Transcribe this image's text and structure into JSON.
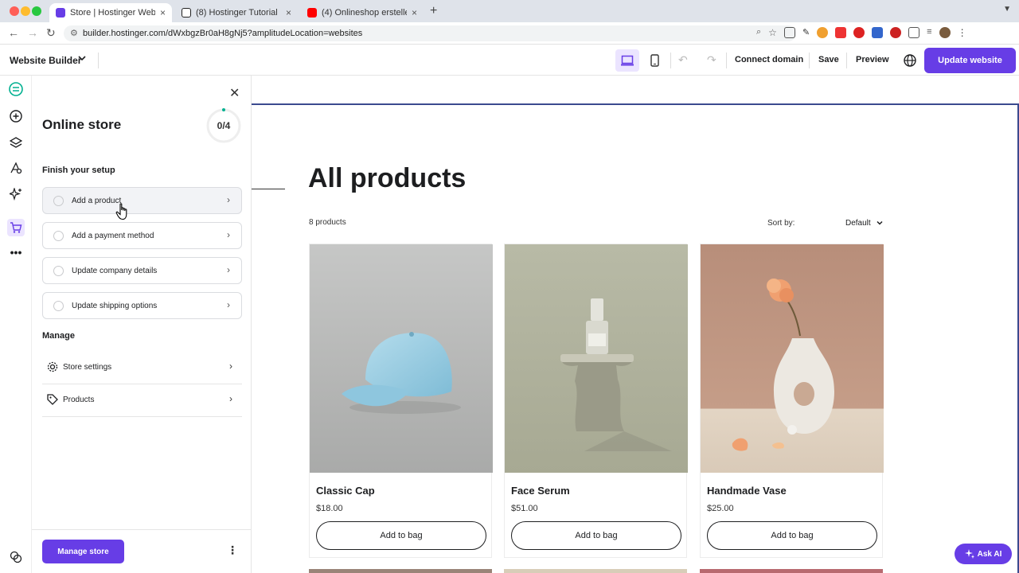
{
  "browser": {
    "tabs": [
      {
        "title": "Store | Hostinger Website Bui",
        "active": true,
        "favicon_color": "#673de6"
      },
      {
        "title": "(8) Hostinger Tutorial",
        "active": false,
        "favicon_color": "#222222"
      },
      {
        "title": "(4) Onlineshop erstellen mit H",
        "active": false,
        "favicon_color": "#ff0000"
      }
    ],
    "url": "builder.hostinger.com/dWxbgzBr0aH8gNj5?amplitudeLocation=websites"
  },
  "topbar": {
    "brand": "Website Builder",
    "connect_domain": "Connect domain",
    "save": "Save",
    "preview": "Preview",
    "update": "Update website"
  },
  "panel": {
    "title": "Online store",
    "progress": "0/4",
    "progress_fraction": 0,
    "setup_heading": "Finish your setup",
    "tasks": [
      {
        "label": "Add a product"
      },
      {
        "label": "Add a payment method"
      },
      {
        "label": "Update company details"
      },
      {
        "label": "Update shipping options"
      }
    ],
    "manage_heading": "Manage",
    "manage_items": [
      {
        "label": "Store settings",
        "icon": "gear-icon"
      },
      {
        "label": "Products",
        "icon": "tag-icon"
      }
    ],
    "manage_button": "Manage store"
  },
  "store": {
    "heading": "All products",
    "count": "8 products",
    "sort_label": "Sort by:",
    "sort_value": "Default",
    "products": [
      {
        "name": "Classic Cap",
        "price": "$18.00",
        "button": "Add to bag"
      },
      {
        "name": "Face Serum",
        "price": "$51.00",
        "button": "Add to bag"
      },
      {
        "name": "Handmade Vase",
        "price": "$25.00",
        "button": "Add to bag"
      }
    ]
  },
  "ask_ai": "Ask AI",
  "colors": {
    "accent": "#673de6",
    "canvas_outline": "#3b4a8f"
  }
}
